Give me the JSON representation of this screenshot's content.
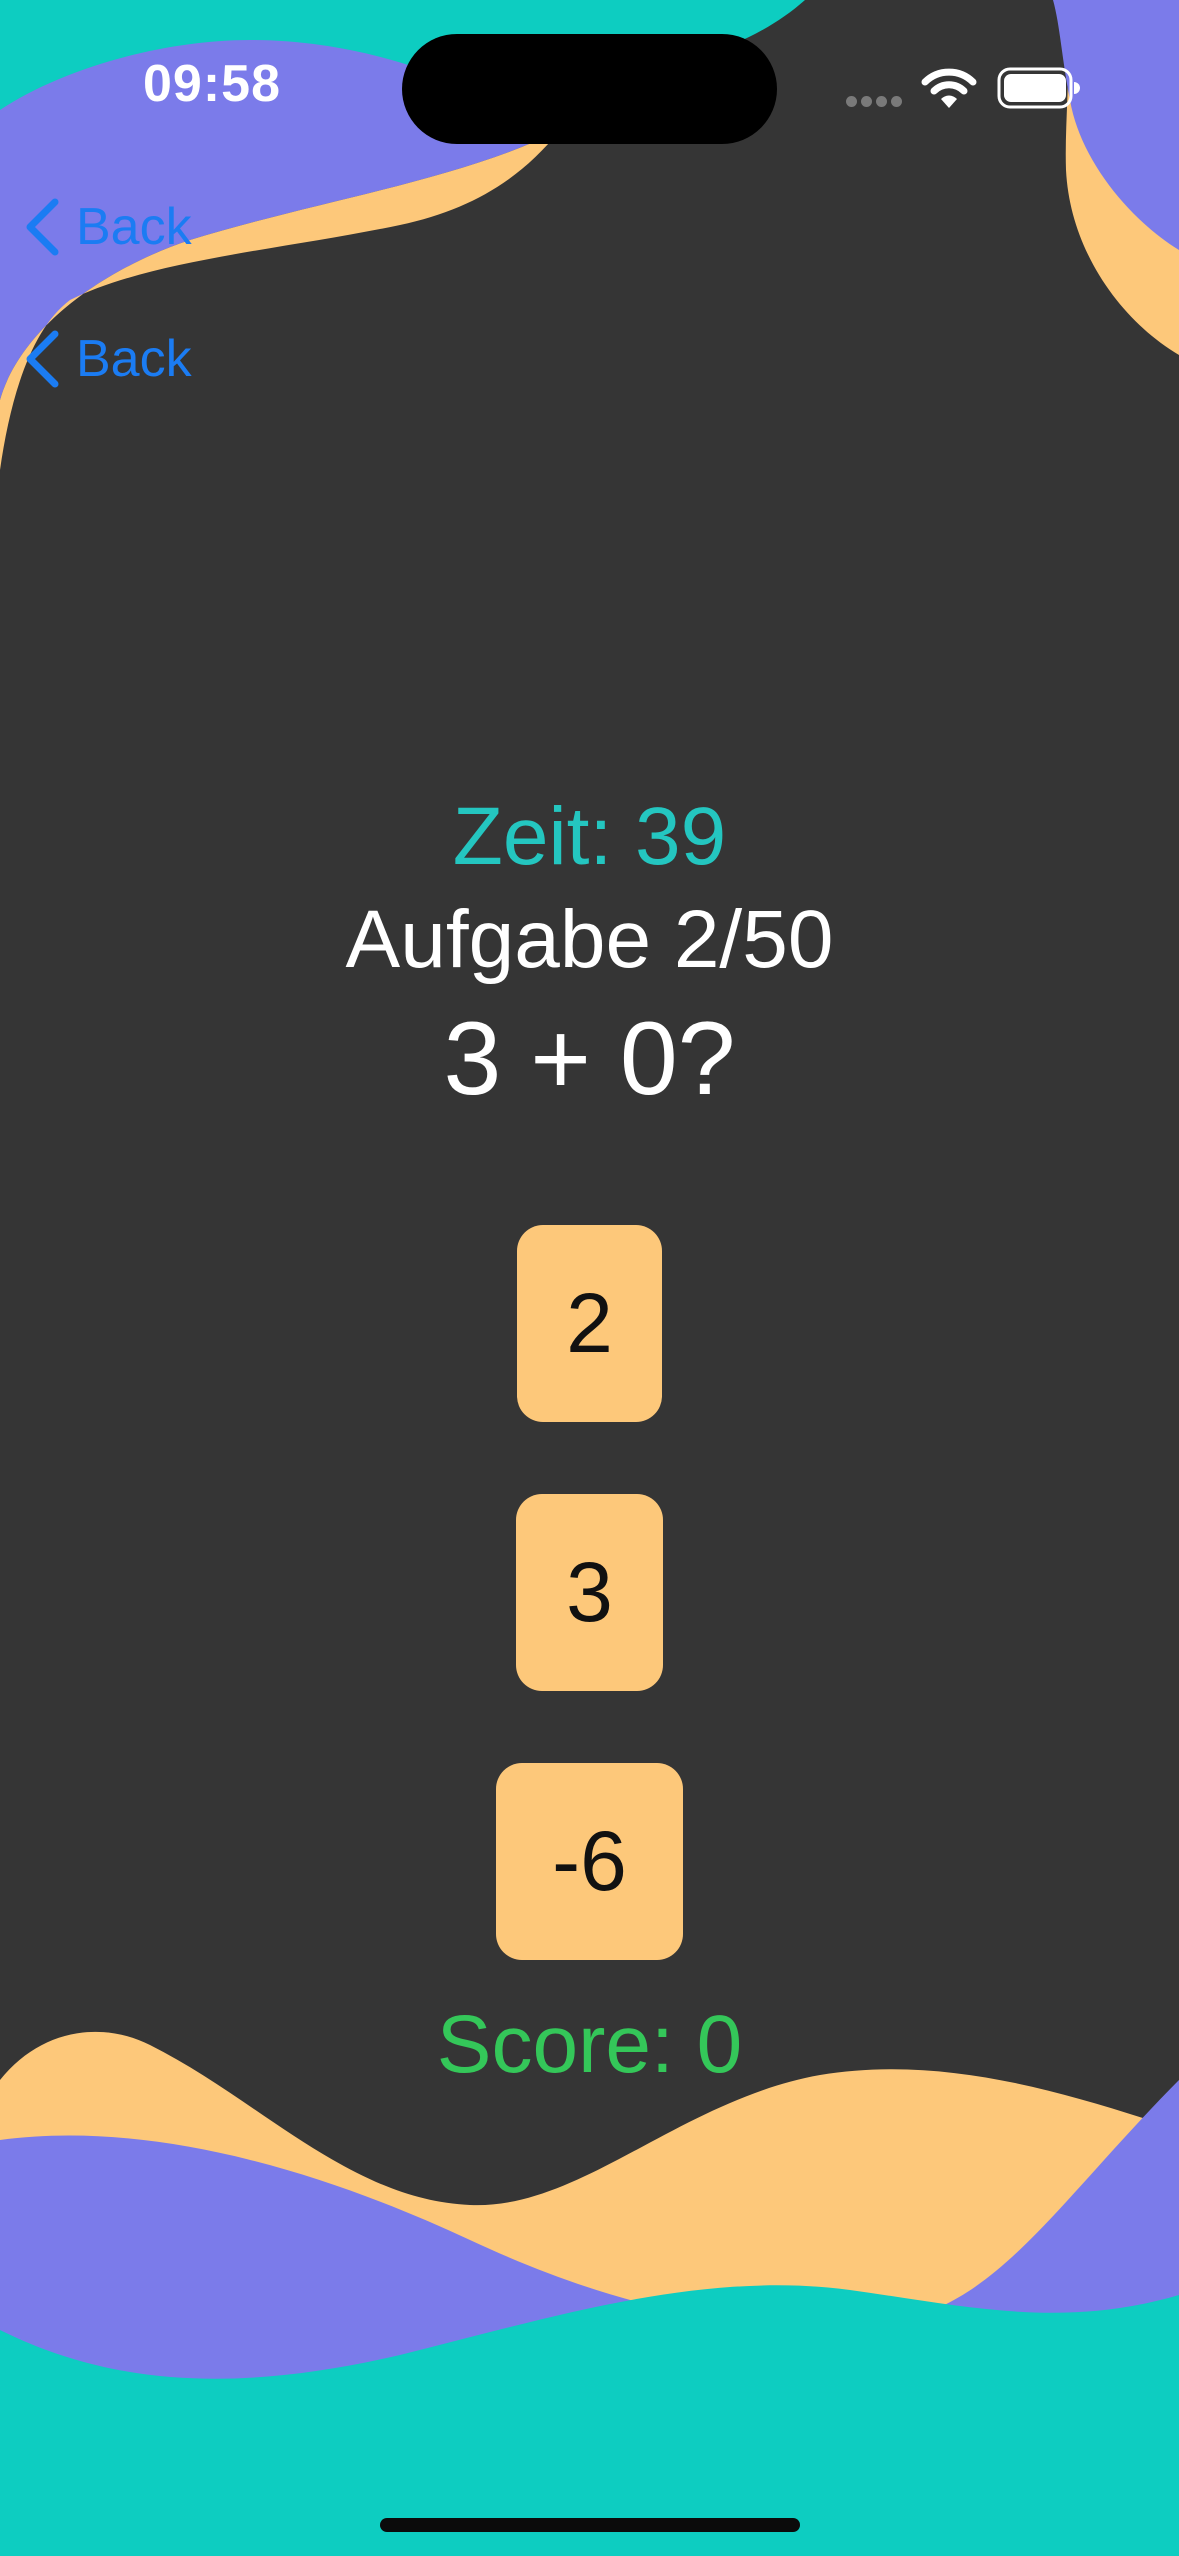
{
  "status_bar": {
    "time": "09:58"
  },
  "nav": {
    "back_label_1": "Back",
    "back_label_2": "Back"
  },
  "game": {
    "timer": "Zeit: 39",
    "task_progress": "Aufgabe 2/50",
    "question": "3 + 0?",
    "answers": [
      "2",
      "3",
      "-6"
    ],
    "score": "Score: 0"
  },
  "colors": {
    "background": "#353535",
    "teal": "#0dcdc1",
    "purple": "#7b7bea",
    "peach": "#fdc87a",
    "link_blue": "#1b7cf3",
    "timer_teal": "#24c6c0",
    "score_green": "#34c759"
  },
  "icons": [
    "back-chevron-icon",
    "wifi-icon",
    "battery-icon"
  ]
}
